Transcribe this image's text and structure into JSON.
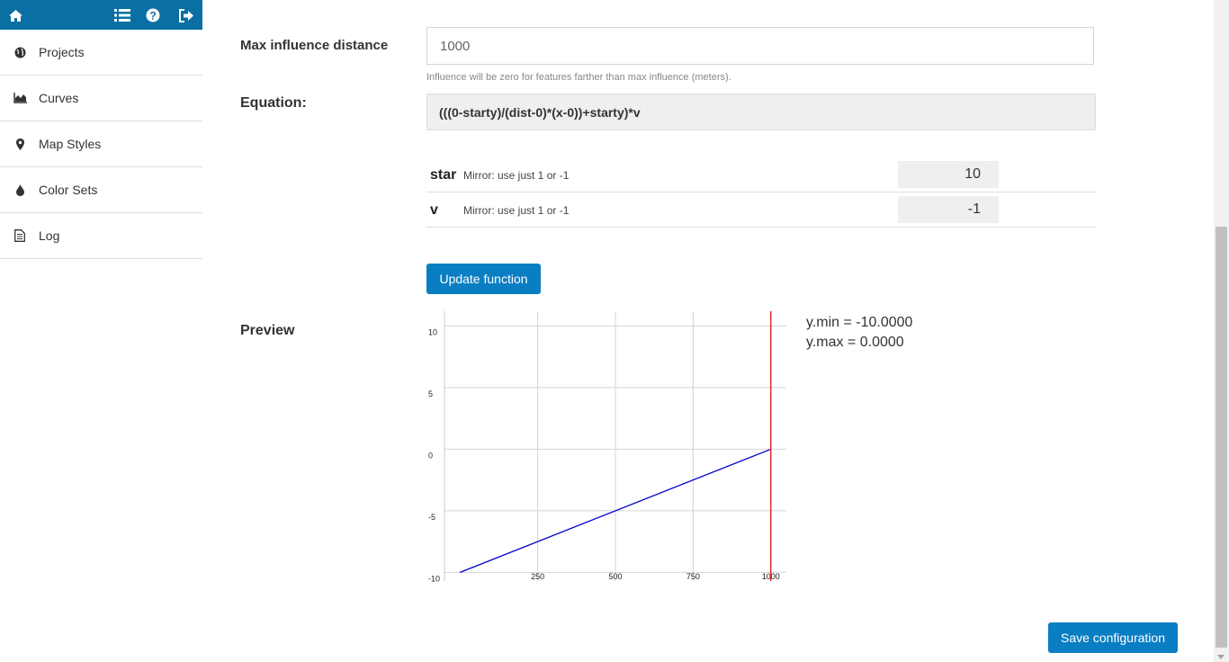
{
  "topbar": {
    "icons": [
      "home-icon",
      "list-icon",
      "help-icon",
      "logout-icon"
    ],
    "color": "#0a6fa3"
  },
  "sidebar": {
    "items": [
      {
        "label": "Projects",
        "icon": "globe-icon"
      },
      {
        "label": "Curves",
        "icon": "area-chart-icon"
      },
      {
        "label": "Map Styles",
        "icon": "map-marker-icon"
      },
      {
        "label": "Color Sets",
        "icon": "tint-icon"
      },
      {
        "label": "Log",
        "icon": "file-text-icon"
      }
    ]
  },
  "form": {
    "max_influence_label": "Max influence distance",
    "max_influence_value": "1000",
    "max_influence_help": "Influence will be zero for features farther than max influence (meters).",
    "equation_label": "Equation:",
    "equation_value": "(((0-starty)/(dist-0)*(x-0))+starty)*v",
    "params": [
      {
        "name": "star",
        "desc": "Mirror: use just 1 or -1",
        "value": "10"
      },
      {
        "name": "v",
        "desc": "Mirror: use just 1 or -1",
        "value": "-1"
      }
    ],
    "update_button": "Update function",
    "preview_label": "Preview",
    "save_button": "Save configuration"
  },
  "preview_stats": {
    "ymin": "y.min = -10.0000",
    "ymax": "y.max = 0.0000"
  },
  "chart_data": {
    "type": "line",
    "x": [
      0,
      1000
    ],
    "series": [
      {
        "values": [
          -10,
          0
        ],
        "color": "#0000cc"
      }
    ],
    "xlim": [
      -50,
      1050
    ],
    "ylim": [
      -10.7,
      11.2
    ],
    "xticks": [
      250,
      500,
      750,
      1000
    ],
    "yticks": [
      10,
      5,
      0,
      -5,
      -10
    ],
    "marker_line": {
      "x": 1000,
      "color": "#e03030"
    },
    "grid": true,
    "title": "",
    "xlabel": "",
    "ylabel": ""
  },
  "colors": {
    "accent": "#0a7ec2",
    "line": "#0000cc",
    "marker": "#e03030"
  }
}
